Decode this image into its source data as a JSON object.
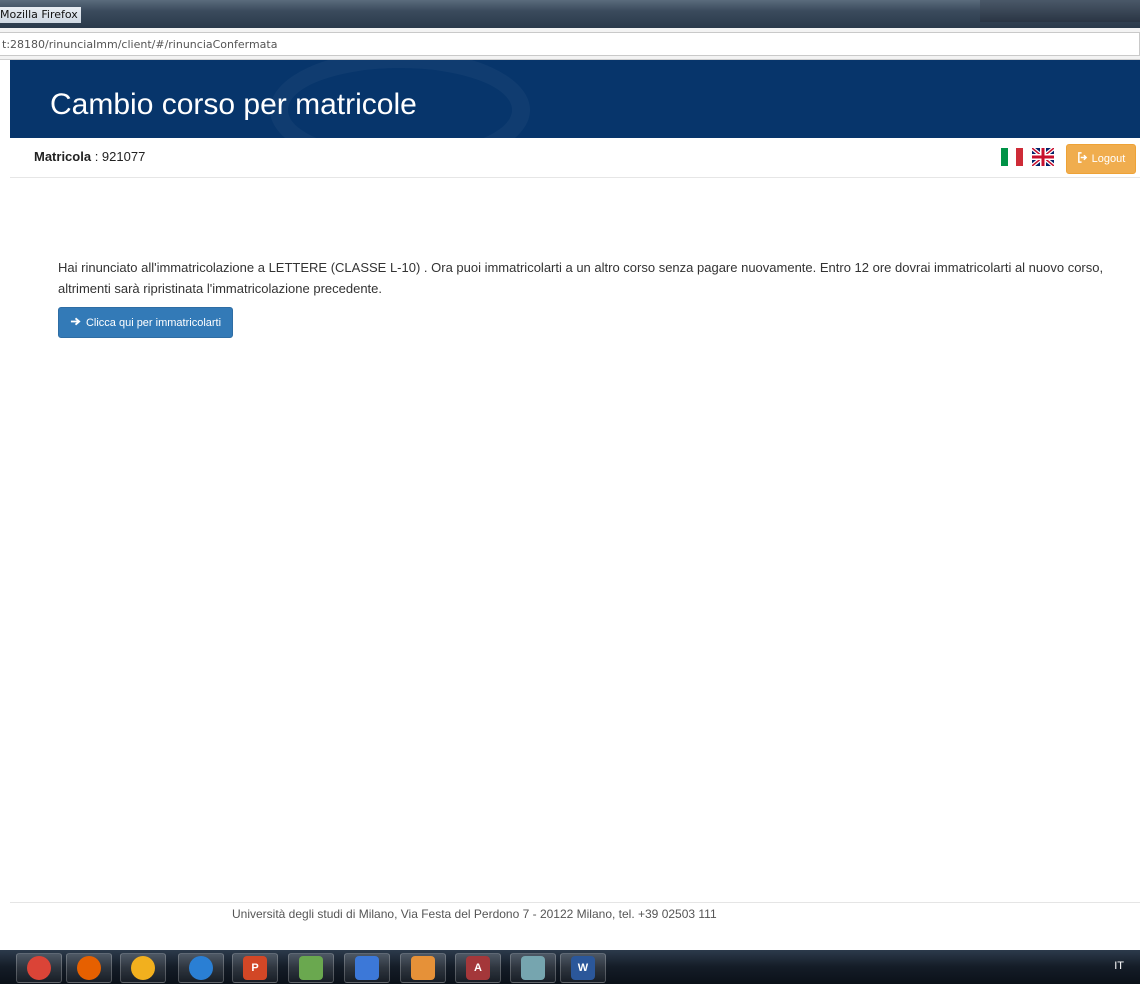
{
  "window": {
    "title": "Mozilla Firefox",
    "url": "t:28180/rinunciaImm/client/#/rinunciaConfermata"
  },
  "header": {
    "title": "Cambio corso per matricole"
  },
  "infobar": {
    "matricola_label": "Matricola",
    "matricola_sep": " : ",
    "matricola_value": "921077",
    "logout_label": "Logout"
  },
  "main": {
    "message": "Hai rinunciato all'immatricolazione a LETTERE (CLASSE L-10) . Ora puoi immatricolarti a un altro corso senza pagare nuovamente. Entro 12 ore dovrai immatricolarti al nuovo corso, altrimenti sarà ripristinata l'immatricolazione precedente.",
    "button_label": "Clicca qui per immatricolarti"
  },
  "footer": {
    "text": "Università degli studi di Milano, Via Festa del Perdono 7 - 20122 Milano, tel. +39 02503 111"
  },
  "taskbar": {
    "items": [
      {
        "icon": "chrome-icon",
        "color": "#db4437"
      },
      {
        "icon": "firefox-icon",
        "color": "#e66000"
      },
      {
        "icon": "thunderbird-icon",
        "color": "#f2b01e"
      },
      {
        "icon": "globe-icon",
        "color": "#2a7fd4"
      },
      {
        "icon": "powerpoint-icon",
        "color": "#d24726"
      },
      {
        "icon": "paint-icon",
        "color": "#6aa84f"
      },
      {
        "icon": "network-icon",
        "color": "#3c78d8"
      },
      {
        "icon": "palette-icon",
        "color": "#e69138"
      },
      {
        "icon": "access-icon",
        "color": "#a4373a"
      },
      {
        "icon": "notes-icon",
        "color": "#76a5af"
      },
      {
        "icon": "word-icon",
        "color": "#2b579a"
      }
    ],
    "tray_text": "IT"
  },
  "colors": {
    "banner": "#07356b",
    "logout": "#f0ad4e",
    "primary": "#337ab7"
  }
}
